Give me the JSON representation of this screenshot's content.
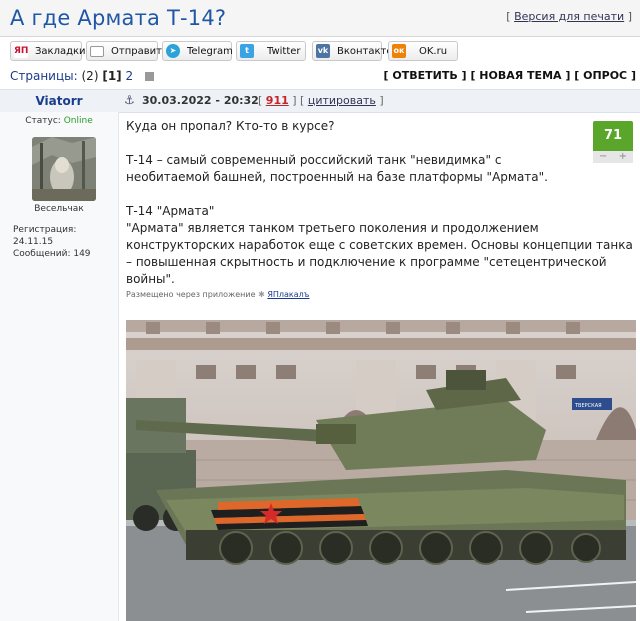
{
  "topic": {
    "title": "А где Армата Т-14?",
    "print_link": "Версия для печати"
  },
  "share": [
    {
      "label": "Закладки",
      "icon": "yaplakal-icon",
      "color": "#c8102e"
    },
    {
      "label": "Отправить",
      "icon": "mail-icon",
      "color": "#8a8a8a"
    },
    {
      "label": "Telegram",
      "icon": "telegram-icon",
      "color": "#2aa3d8"
    },
    {
      "label": "Twitter",
      "icon": "twitter-icon",
      "color": "#3aa3e3"
    },
    {
      "label": "Вконтакте",
      "icon": "vk-icon",
      "color": "#4c75a3"
    },
    {
      "label": "OK.ru",
      "icon": "odnoklassniki-icon",
      "color": "#ee8208"
    }
  ],
  "pagination": {
    "label": "Страницы:",
    "count": "(2)",
    "current": "[1]",
    "next": "2"
  },
  "actions": {
    "reply": "[ ОТВЕТИТЬ ]",
    "new_topic": "[ НОВАЯ ТЕМА ]",
    "poll": "[ ОПРОС ]"
  },
  "post": {
    "author": "Viatorr",
    "date": "30.03.2022 - 20:32",
    "number": "911",
    "quote": "цитировать",
    "status_label": "Статус:",
    "status_value": "Online",
    "user_title": "Весельчак",
    "reg_label": "Регистрация:",
    "reg_value": "24.11.15",
    "msgs_label": "Сообщений:",
    "msgs_value": "149",
    "rating": "71",
    "paragraphs": [
      "Куда он пропал? Кто-то в курсе?",
      "Т-14 – самый современный российский танк \"невидимка\" с необитаемой башней, построенный на базе платформы \"Армата\".",
      "Т-14 \"Армата\"",
      "\"Армата\" является танком третьего поколения и продолжением конструкторских наработок еще с советских времен. Основы концепции танка – повышенная скрытность и подключение к программе \"сетецентрической войны\"."
    ],
    "via_label": "Размещено через приложение",
    "via_app": "ЯПлакалъ",
    "street_sign": "ТВЕРСКАЯ"
  }
}
